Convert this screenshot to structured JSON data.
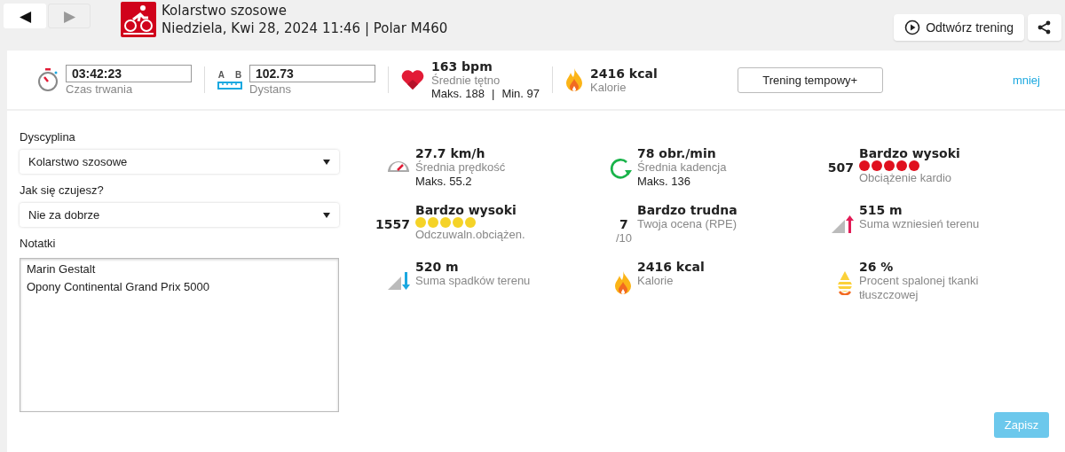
{
  "header": {
    "nav": [
      {
        "label": "◀",
        "disabled": false
      },
      {
        "label": "▶",
        "disabled": true
      }
    ],
    "title": "Kolarstwo szosowe",
    "subtitle": "Niedziela, Kwi 28, 2024 11:46 | Polar M460",
    "replay_button": "Odtwórz trening"
  },
  "summary": {
    "duration": {
      "value": "03:42:23",
      "label": "Czas trwania"
    },
    "distance": {
      "value": "102.73",
      "label": "Dystans",
      "a": "A",
      "b": "B"
    },
    "heart": {
      "value": "163 bpm",
      "label": "Średnie tętno",
      "max": "Maks. 188",
      "sep": "|",
      "min": "Min. 97"
    },
    "calories": {
      "value": "2416 kcal",
      "label": "Kalorie"
    },
    "training_button": "Trening tempowy+",
    "less_link": "mniej"
  },
  "form": {
    "discipline": {
      "label": "Dyscyplina",
      "value": "Kolarstwo szosowe"
    },
    "feeling": {
      "label": "Jak się czujesz?",
      "value": "Nie za dobrze"
    },
    "notes": {
      "label": "Notatki",
      "value": "Marin Gestalt\nOpony Continental Grand Prix 5000"
    }
  },
  "metrics": [
    {
      "kind": "speed",
      "value": "27.7 km/h",
      "label": "Średnia prędkość",
      "extra": "Maks. 55.2"
    },
    {
      "kind": "cadence",
      "value": "78 obr./min",
      "label": "Średnia kadencja",
      "extra": "Maks. 136"
    },
    {
      "kind": "load",
      "value": "Bardzo wysoki",
      "score": "507",
      "stars": 5,
      "color": "#e0101e",
      "label": "Obciążenie kardio"
    },
    {
      "kind": "load",
      "value": "Bardzo wysoki",
      "score": "1557",
      "stars": 5,
      "color": "#f5d327",
      "label": "Odczuwaln.obciążen."
    },
    {
      "kind": "rpe",
      "value": "Bardzo trudna",
      "score": "7",
      "scale": "/10",
      "label": "Twoja ocena (RPE)"
    },
    {
      "kind": "ascent",
      "value": "515 m",
      "label": "Suma wzniesień terenu"
    },
    {
      "kind": "descent",
      "value": "520 m",
      "label": "Suma spadków terenu"
    },
    {
      "kind": "calories",
      "value": "2416 kcal",
      "label": "Kalorie"
    },
    {
      "kind": "fat",
      "value": "26 %",
      "label": "Procent spalonej tkanki tłuszczowej"
    }
  ],
  "save_button": "Zapisz"
}
